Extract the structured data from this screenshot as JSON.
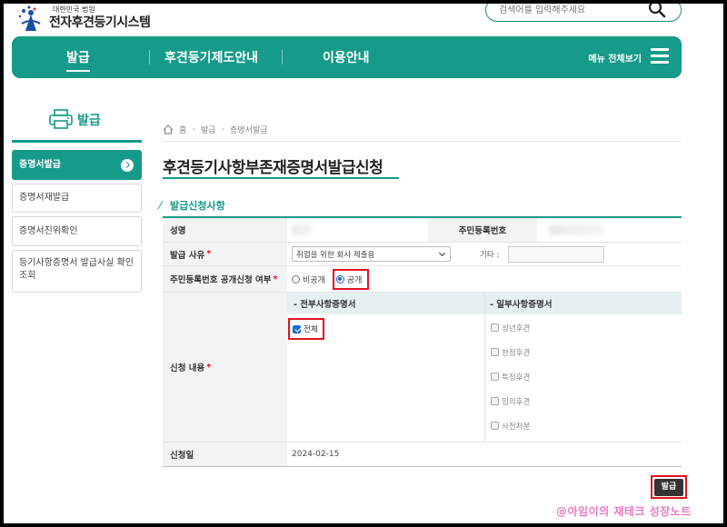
{
  "header": {
    "logo_small": "대한민국 법원",
    "logo_big": "전자후견등기시스템",
    "search_placeholder": "검색어를 입력해주세요"
  },
  "nav": {
    "items": [
      "발급",
      "후견등기제도안내",
      "이용안내"
    ],
    "menu_label": "메뉴 전체보기"
  },
  "sidebar": {
    "title": "발급",
    "items": [
      {
        "label": "증명서발급",
        "active": true
      },
      {
        "label": "증명서재발급"
      },
      {
        "label": "증명서진위확인"
      },
      {
        "label": "등기사항증명서 발급사실 확인조회"
      }
    ]
  },
  "breadcrumb": [
    "홈",
    "발급",
    "증명서발급"
  ],
  "page_title": "후견등기사항부존재증명서발급신청",
  "section_title": "발급신청사항",
  "form": {
    "name_label": "성명",
    "rrn_label": "주민등록번호",
    "reason_label": "발급 사유",
    "reason_value": "취업을 위한 회사 제출용",
    "etc_label": "기타 :",
    "disclosure_label": "주민등록번호 공개신청 여부",
    "radio_private": "비공개",
    "radio_public": "공개",
    "radio_selected": "공개",
    "content_label": "신청 내용",
    "all_items_head": "- 전부사항증명서",
    "partial_items_head": "- 일부사항증명서",
    "all_option": "전체",
    "all_option_checked": true,
    "partial_options": [
      "성년후견",
      "한정후견",
      "특정후견",
      "임의후견",
      "사전처분"
    ],
    "date_label": "신청일",
    "date_value": "2024-02-15",
    "required_mark": "*"
  },
  "issue_button": "발급",
  "watermark": "@아임이의 재테크 성장노트",
  "colors": {
    "brand": "#169a89",
    "highlight": "#e0141e",
    "watermark": "#e979c5"
  }
}
